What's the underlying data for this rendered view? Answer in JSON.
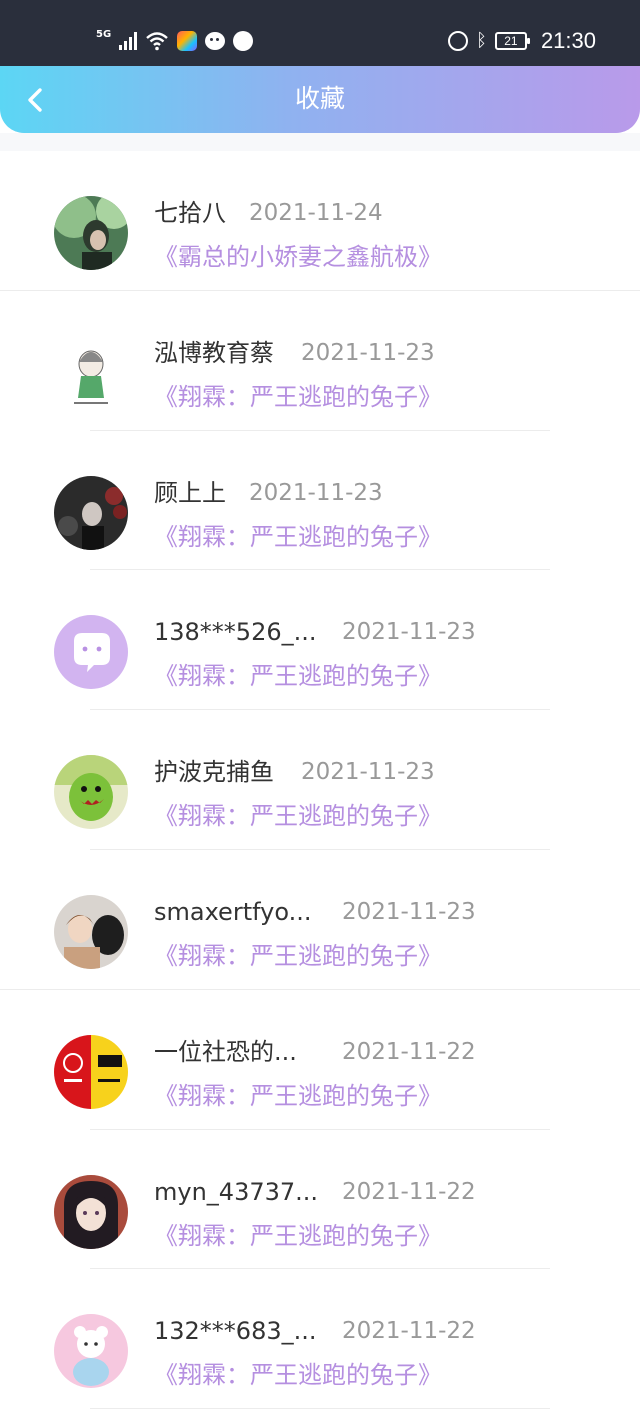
{
  "status_bar": {
    "network": "5G",
    "battery": "21",
    "time": "21:30"
  },
  "header": {
    "title": "收藏"
  },
  "favorites": [
    {
      "username": "七拾八",
      "date": "2021-11-24",
      "book": "《霸总的小娇妻之鑫航极》",
      "avatar": "avatar-photo-green-forest"
    },
    {
      "username": "泓博教育蔡",
      "date": "2021-11-23",
      "book": "《翔霖：严王逃跑的兔子》",
      "avatar": "avatar-cartoon-girl-sketch"
    },
    {
      "username": "顾上上",
      "date": "2021-11-23",
      "book": "《翔霖：严王逃跑的兔子》",
      "avatar": "avatar-photo-dark-roses"
    },
    {
      "username": "138***526_...",
      "date": "2021-11-23",
      "book": "《翔霖：严王逃跑的兔子》",
      "avatar": "avatar-default-purple-chat"
    },
    {
      "username": "护波克捕鱼",
      "date": "2021-11-23",
      "book": "《翔霖：严王逃跑的兔子》",
      "avatar": "avatar-green-plush-monster"
    },
    {
      "username": "smaxertfyo...",
      "date": "2021-11-23",
      "book": "《翔霖：严王逃跑的兔子》",
      "avatar": "avatar-photo-people"
    },
    {
      "username": "一位社恐的...",
      "date": "2021-11-22",
      "book": "《翔霖：严王逃跑的兔子》",
      "avatar": "avatar-red-yellow-tnt-logo"
    },
    {
      "username": "myn_43737...",
      "date": "2021-11-22",
      "book": "《翔霖：严王逃跑的兔子》",
      "avatar": "avatar-anime-dark-hair"
    },
    {
      "username": "132***683_...",
      "date": "2021-11-22",
      "book": "《翔霖：严王逃跑的兔子》",
      "avatar": "avatar-pink-cartoon-bear"
    }
  ],
  "colors": {
    "header_gradient_start": "#5cd6f4",
    "header_gradient_end": "#b99aea",
    "book_title": "#b58fe0",
    "username": "#333333",
    "date": "#999999",
    "status_bar": "#2a2f3c"
  }
}
